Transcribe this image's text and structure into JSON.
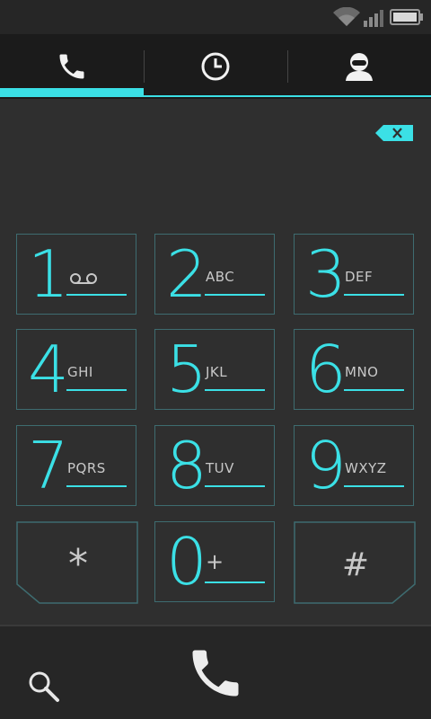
{
  "status_bar": {
    "icons": [
      "wifi-icon",
      "signal-icon",
      "battery-icon"
    ]
  },
  "tabs": [
    {
      "name": "dialpad",
      "icon": "phone-icon",
      "selected": true
    },
    {
      "name": "call-log",
      "icon": "clock-icon",
      "selected": false
    },
    {
      "name": "contacts",
      "icon": "person-icon",
      "selected": false
    }
  ],
  "digits_field": {
    "value": ""
  },
  "keys": [
    {
      "digit": "1",
      "letters": "",
      "extra_icon": "voicemail-icon"
    },
    {
      "digit": "2",
      "letters": "ABC"
    },
    {
      "digit": "3",
      "letters": "DEF"
    },
    {
      "digit": "4",
      "letters": "GHI"
    },
    {
      "digit": "5",
      "letters": "JKL"
    },
    {
      "digit": "6",
      "letters": "MNO"
    },
    {
      "digit": "7",
      "letters": "PQRS"
    },
    {
      "digit": "8",
      "letters": "TUV"
    },
    {
      "digit": "9",
      "letters": "WXYZ"
    },
    {
      "digit": "*",
      "letters": ""
    },
    {
      "digit": "0",
      "letters": "+"
    },
    {
      "digit": "#",
      "letters": ""
    }
  ],
  "bottom_bar": {
    "left_icon": "search-icon",
    "center_icon": "call-icon"
  },
  "colors": {
    "accent": "#3be0e6",
    "key_border": "#3e6c70",
    "background": "#2f2f2f",
    "tab_bar": "#1b1b1b"
  }
}
